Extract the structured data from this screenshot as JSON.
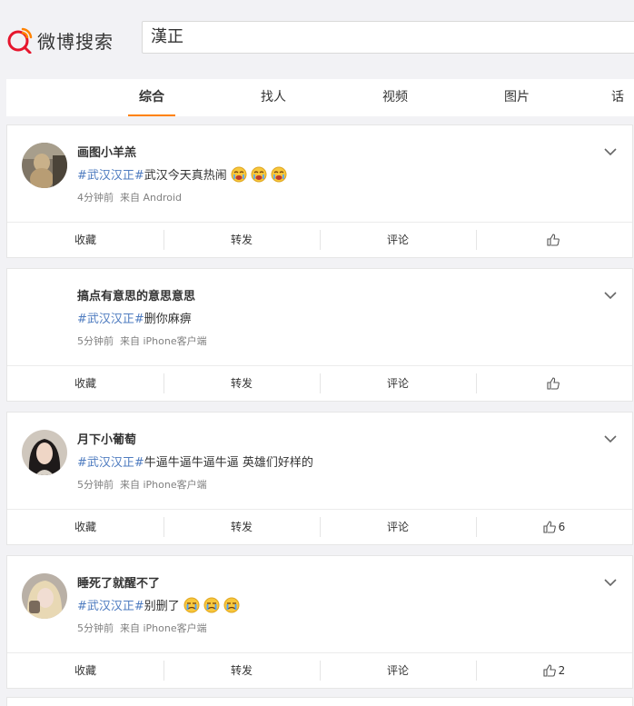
{
  "app": {
    "logo_text": "微博搜索",
    "brand_color": "#ff8200",
    "topic_color": "#4f7cc0"
  },
  "search": {
    "query": "漢正"
  },
  "tabs": [
    {
      "label": "综合",
      "active": true
    },
    {
      "label": "找人"
    },
    {
      "label": "视频"
    },
    {
      "label": "图片"
    },
    {
      "label": "话"
    }
  ],
  "actions": {
    "favorite": "收藏",
    "repost": "转发",
    "comment": "评论"
  },
  "posts": [
    {
      "username": "画图小羊羔",
      "topic": "#武汉汉正#",
      "text": "武汉今天真热闹",
      "emoji": [
        "crying-face-icon",
        "crying-face-icon",
        "crying-face-icon"
      ],
      "time": "4分钟前",
      "source": "来自 Android",
      "likes": ""
    },
    {
      "username": "搞点有意思的意思意思",
      "topic": "#武汉汉正#",
      "text": "删你麻痹",
      "emoji": [],
      "time": "5分钟前",
      "source": "来自 iPhone客户端",
      "likes": ""
    },
    {
      "username": "月下小葡萄",
      "topic": "#武汉汉正#",
      "text": "牛逼牛逼牛逼牛逼 英雄们好样的",
      "emoji": [],
      "time": "5分钟前",
      "source": "来自 iPhone客户端",
      "likes": "6"
    },
    {
      "username": "睡死了就醒不了",
      "topic": "#武汉汉正#",
      "text": "别删了",
      "emoji": [
        "tearful-face-icon",
        "tearful-face-icon",
        "tearful-face-icon"
      ],
      "time": "5分钟前",
      "source": "来自 iPhone客户端",
      "likes": "2"
    }
  ]
}
